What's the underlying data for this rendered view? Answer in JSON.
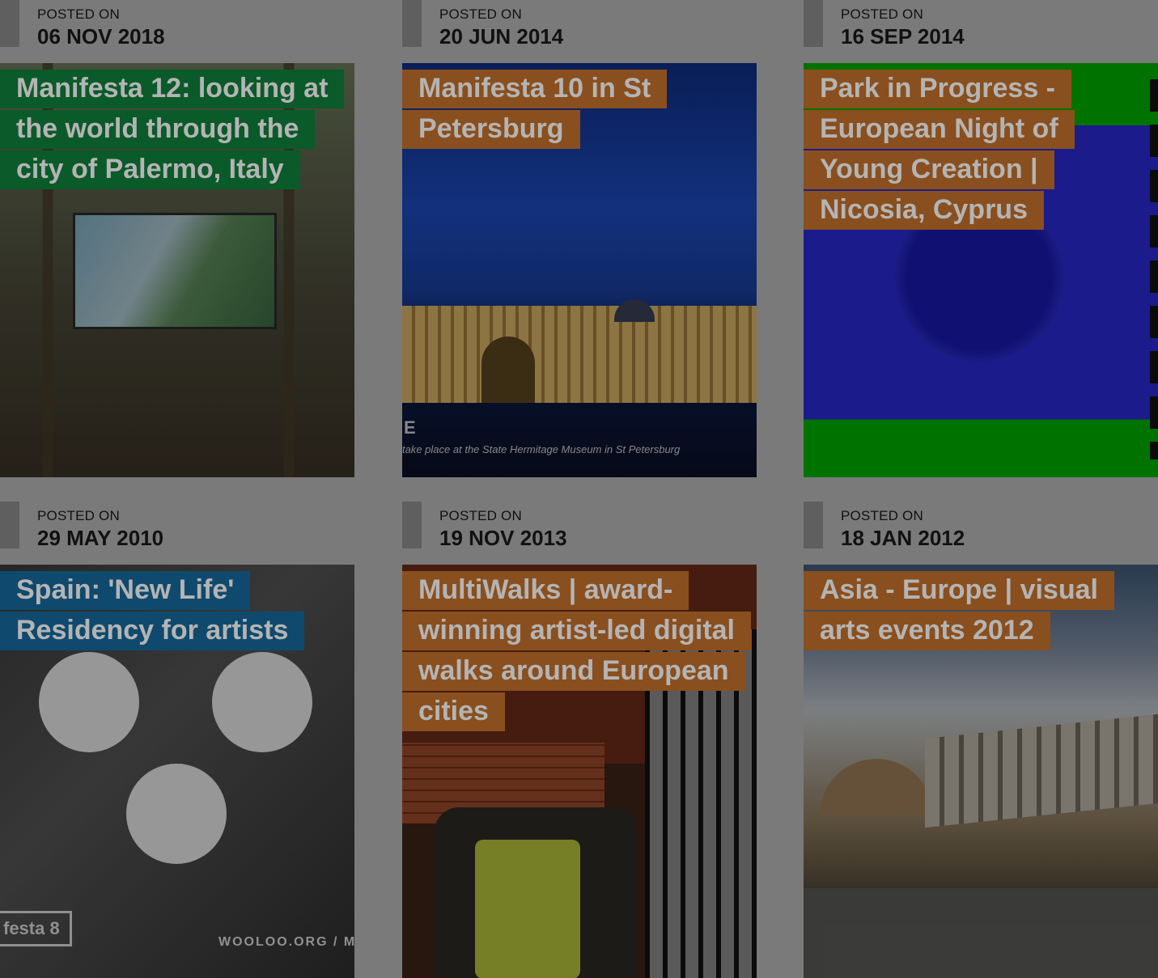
{
  "cards": [
    {
      "posted_label": "POSTED ON",
      "date": "06 NOV 2018",
      "title": "Manifesta 12: looking at the world through the city of Palermo, Italy",
      "label_color": "#0b5a2a"
    },
    {
      "posted_label": "POSTED ON",
      "date": "20 JUN 2014",
      "title": "Manifesta 10 in St Petersburg",
      "label_color": "#8a4f1e",
      "image_text": {
        "letter": "E",
        "caption": "take place at the State Hermitage Museum in St Petersburg"
      }
    },
    {
      "posted_label": "POSTED ON",
      "date": "16 SEP 2014",
      "title": "Park in Progress - European Night of Young Creation | Nicosia, Cyprus",
      "label_color": "#8a4f1e"
    },
    {
      "posted_label": "POSTED ON",
      "date": "29 MAY 2010",
      "title": "Spain: 'New Life' Residency for artists",
      "label_color": "#0f4a6e",
      "image_text": {
        "badge": "festa 8",
        "site": "WOOLOO.ORG / M"
      }
    },
    {
      "posted_label": "POSTED ON",
      "date": "19 NOV 2013",
      "title": "MultiWalks | award-winning artist-led digital walks around European cities",
      "label_color": "#8a4f1e"
    },
    {
      "posted_label": "POSTED ON",
      "date": "18 JAN 2012",
      "title": "Asia - Europe | visual arts events 2012",
      "label_color": "#8a4f1e"
    }
  ]
}
